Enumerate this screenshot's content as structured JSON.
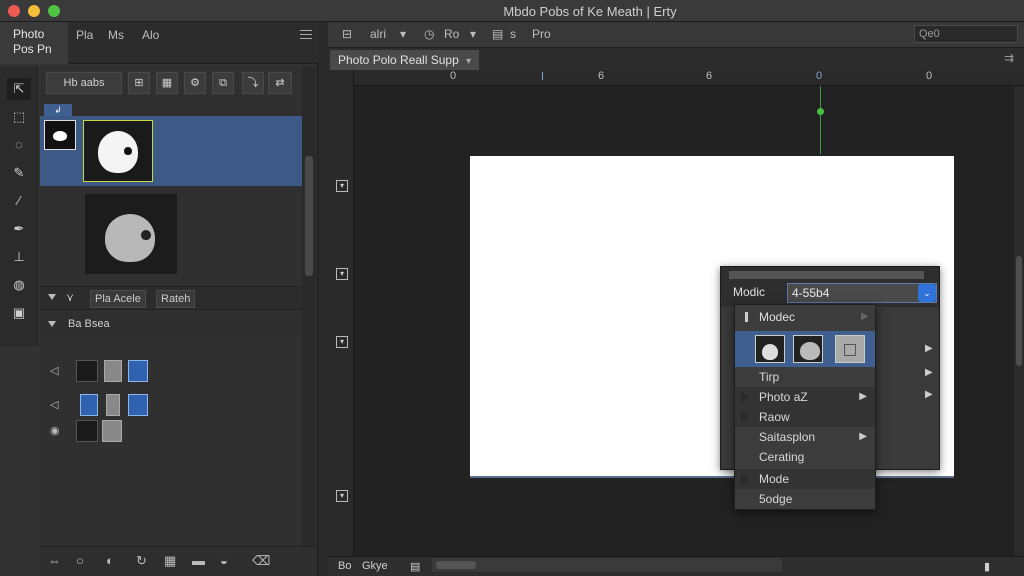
{
  "window": {
    "title": "Mbdo Pobs of Ke Meath | Erty"
  },
  "app": {
    "name_line1": "Photo",
    "name_line2": "Pos Pn"
  },
  "panel_tabs": [
    "Pla",
    "Ms",
    "Alo"
  ],
  "layer_toolbar": {
    "label": "Hb aabs"
  },
  "layers": {
    "group1_label": "Pla Acele",
    "group1_button": "Rateh",
    "group2_label": "Ba Bsea"
  },
  "options_bar": {
    "item1": "alri",
    "item2": "Ro",
    "item3": "Pro",
    "search_placeholder": "Qe0"
  },
  "doc_tab": {
    "title": "Photo Polo Reall Supp"
  },
  "ruler": {
    "ticks": [
      "0",
      "6",
      "6",
      "0",
      "0"
    ]
  },
  "floating_panel": {
    "mode_label": "Modic",
    "mode_value": "4-55b4"
  },
  "context_menu": {
    "header": "Modec",
    "items": [
      {
        "label": "Tirp",
        "submenu": false,
        "marked": false
      },
      {
        "label": "Photo aZ",
        "submenu": true,
        "marked": true
      },
      {
        "label": "Raow",
        "submenu": false,
        "marked": true
      },
      {
        "label": "Saitasplon",
        "submenu": true,
        "marked": false
      },
      {
        "label": "Cerating",
        "submenu": false,
        "marked": false
      },
      {
        "label": "Mode",
        "submenu": false,
        "marked": true
      },
      {
        "label": "5odge",
        "submenu": false,
        "marked": false
      }
    ]
  },
  "status_bar": {
    "left": "Bo",
    "doc": "Gkye"
  },
  "colors": {
    "accent": "#3c5a85",
    "selection_blue": "#2f72d8",
    "guide_green": "#48c048"
  }
}
